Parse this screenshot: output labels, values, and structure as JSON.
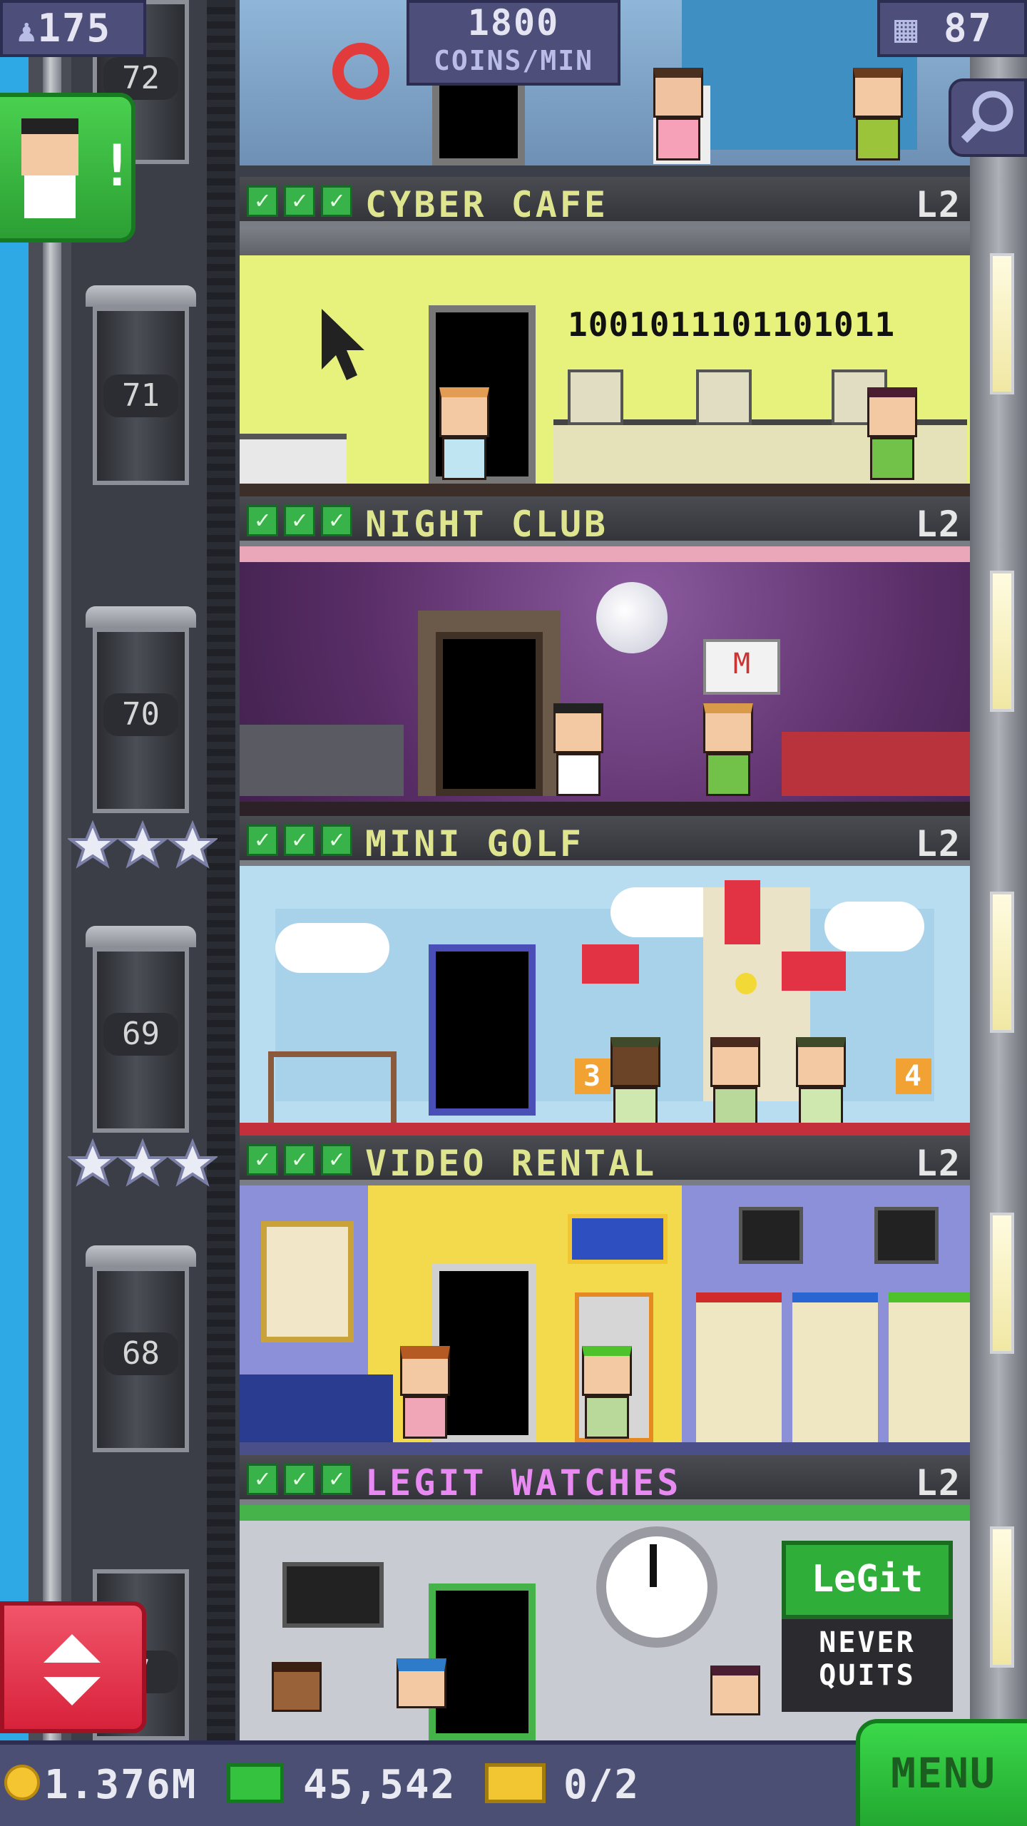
{
  "hud": {
    "population": "175",
    "coins_rate_value": "1800",
    "coins_rate_unit": "COINS/MIN",
    "floors": "87"
  },
  "elevator": {
    "floor_numbers": [
      "72",
      "71",
      "70",
      "69",
      "68",
      "7"
    ],
    "star_rows": 2
  },
  "floors": [
    {
      "name": "CYBER CAFE",
      "level": "L2",
      "checks": 3,
      "color": "#dfe58f",
      "bg": "#e7f27d",
      "binary": "1001011101101011"
    },
    {
      "name": "NIGHT CLUB",
      "level": "L2",
      "checks": 3,
      "color": "#dfe58f",
      "bg": "#6b3b75"
    },
    {
      "name": "MINI GOLF",
      "level": "L2",
      "checks": 3,
      "color": "#dfe58f",
      "bg": "#b9ddf0",
      "hole_a": "3",
      "hole_b": "4"
    },
    {
      "name": "VIDEO RENTAL",
      "level": "L2",
      "checks": 3,
      "color": "#dfe58f",
      "bg": "#f3da4c"
    },
    {
      "name": "LEGIT WATCHES",
      "level": "L2",
      "checks": 3,
      "color": "#e88af2",
      "bg": "#c9cbd3",
      "sign_top": "LeGit",
      "sign_bottom": "NEVER QUITS"
    }
  ],
  "bottom": {
    "coins": "1.376M",
    "bux": "45,542",
    "tickets": "0/2",
    "menu_label": "MENU"
  },
  "icons": [
    "population-icon",
    "floors-icon",
    "search-icon",
    "alert-icon",
    "elevator-arrows-icon",
    "coin-icon",
    "bux-icon",
    "ticket-icon",
    "check-icon",
    "star-icon"
  ]
}
